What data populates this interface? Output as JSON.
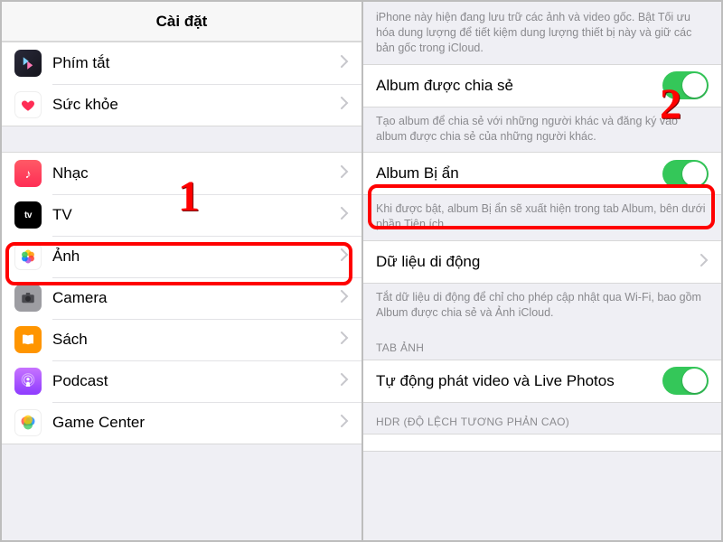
{
  "left": {
    "title": "Cài đặt",
    "group1": [
      {
        "label": "Phím tắt",
        "icon": "shortcuts"
      },
      {
        "label": "Sức khỏe",
        "icon": "health"
      }
    ],
    "group2": [
      {
        "label": "Nhạc",
        "icon": "music"
      },
      {
        "label": "TV",
        "icon": "tv"
      },
      {
        "label": "Ảnh",
        "icon": "photos"
      },
      {
        "label": "Camera",
        "icon": "camera"
      },
      {
        "label": "Sách",
        "icon": "books"
      },
      {
        "label": "Podcast",
        "icon": "podcast"
      },
      {
        "label": "Game Center",
        "icon": "gamecenter"
      }
    ]
  },
  "right": {
    "topNote": "iPhone này hiện đang lưu trữ các ảnh và video gốc. Bật Tối ưu hóa dung lượng để tiết kiệm dung lượng thiết bị này và giữ các bản gốc trong iCloud.",
    "sharedAlbum": {
      "label": "Album được chia sẻ",
      "on": true
    },
    "sharedNote": "Tạo album để chia sẻ với những người khác và đăng ký vào album được chia sẻ của những người khác.",
    "hiddenAlbum": {
      "label": "Album Bị ẩn",
      "on": true
    },
    "hiddenNote": "Khi được bật, album Bị ẩn sẽ xuất hiện trong tab Album, bên dưới phần Tiện ích.",
    "mobileData": {
      "label": "Dữ liệu di động"
    },
    "mobileNote": "Tắt dữ liệu di động để chỉ cho phép cập nhật qua Wi-Fi, bao gồm Album được chia sẻ và Ảnh iCloud.",
    "sectionTab": "TAB ẢNH",
    "autoplay": {
      "label": "Tự động phát video và Live Photos",
      "on": true
    },
    "sectionHdr": "HDR (ĐỘ LỆCH TƯƠNG PHẢN CAO)"
  },
  "annotations": {
    "one": "1",
    "two": "2"
  }
}
